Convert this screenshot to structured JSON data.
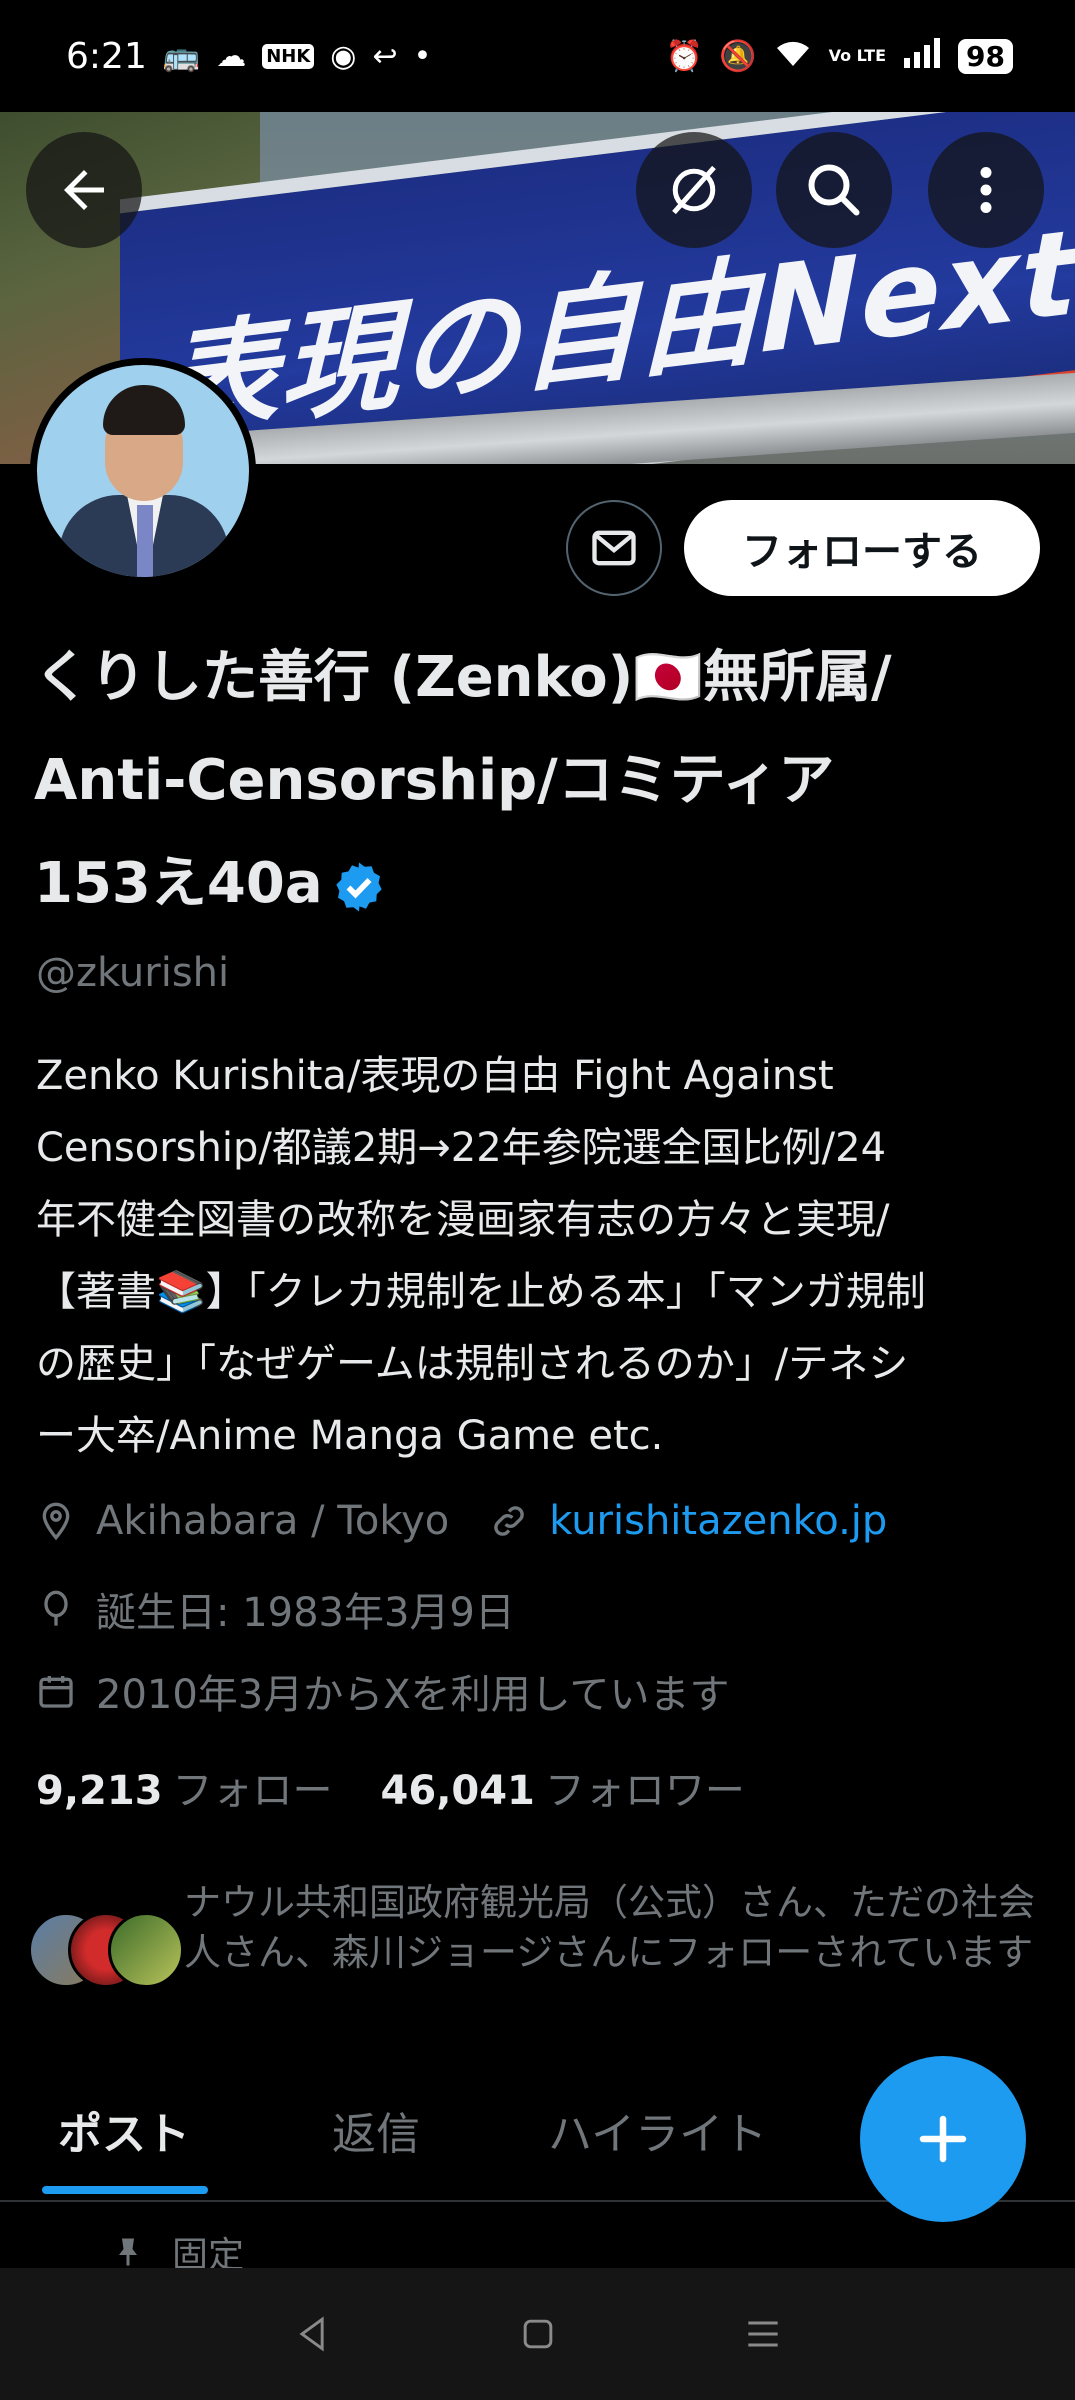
{
  "status_bar": {
    "time": "6:21",
    "nhk": "NHK",
    "volte": "Vo LTE",
    "battery": "98"
  },
  "banner": {
    "sign_text": "表現の自由Next"
  },
  "profile": {
    "follow_label": "フォローする",
    "name_line1": "くりした善行 (Zenko)🇯🇵無所属/",
    "name_line2": "Anti-Censorship/コミティア",
    "name_line3": "153え40a",
    "handle": "@zkurishi",
    "bio": "Zenko Kurishita/表現の自由 Fight Against\nCensorship/都議2期→22年参院選全国比例/24\n年不健全図書の改称を漫画家有志の方々と実現/\n【著書📚】「クレカ規制を止める本」「マンガ規制\nの歴史」「なぜゲームは規制されるのか」/テネシ\nー大卒/Anime Manga Game etc.",
    "location": "Akihabara / Tokyo",
    "website": "kurishitazenko.jp",
    "birthday": "誕生日: 1983年3月9日",
    "joined": "2010年3月からXを利用しています",
    "following_count": "9,213",
    "following_label": "フォロー",
    "followers_count": "46,041",
    "followers_label": "フォロワー",
    "followed_by": "ナウル共和国政府観光局（公式）さん、ただの社会人さん、森川ジョージさんにフォローされています"
  },
  "tabs": [
    {
      "label": "ポスト",
      "active": true
    },
    {
      "label": "返信",
      "active": false
    },
    {
      "label": "ハイライト",
      "active": false
    }
  ],
  "pinned_label": "固定",
  "colors": {
    "accent": "#1d9bf0",
    "background": "#000000",
    "secondary_text": "#71767b"
  },
  "icons": [
    "back-arrow-icon",
    "grok-icon",
    "search-icon",
    "more-vertical-icon",
    "mail-icon",
    "verified-badge-icon",
    "location-icon",
    "link-icon",
    "birthday-balloon-icon",
    "calendar-icon",
    "plus-icon",
    "pin-icon"
  ]
}
